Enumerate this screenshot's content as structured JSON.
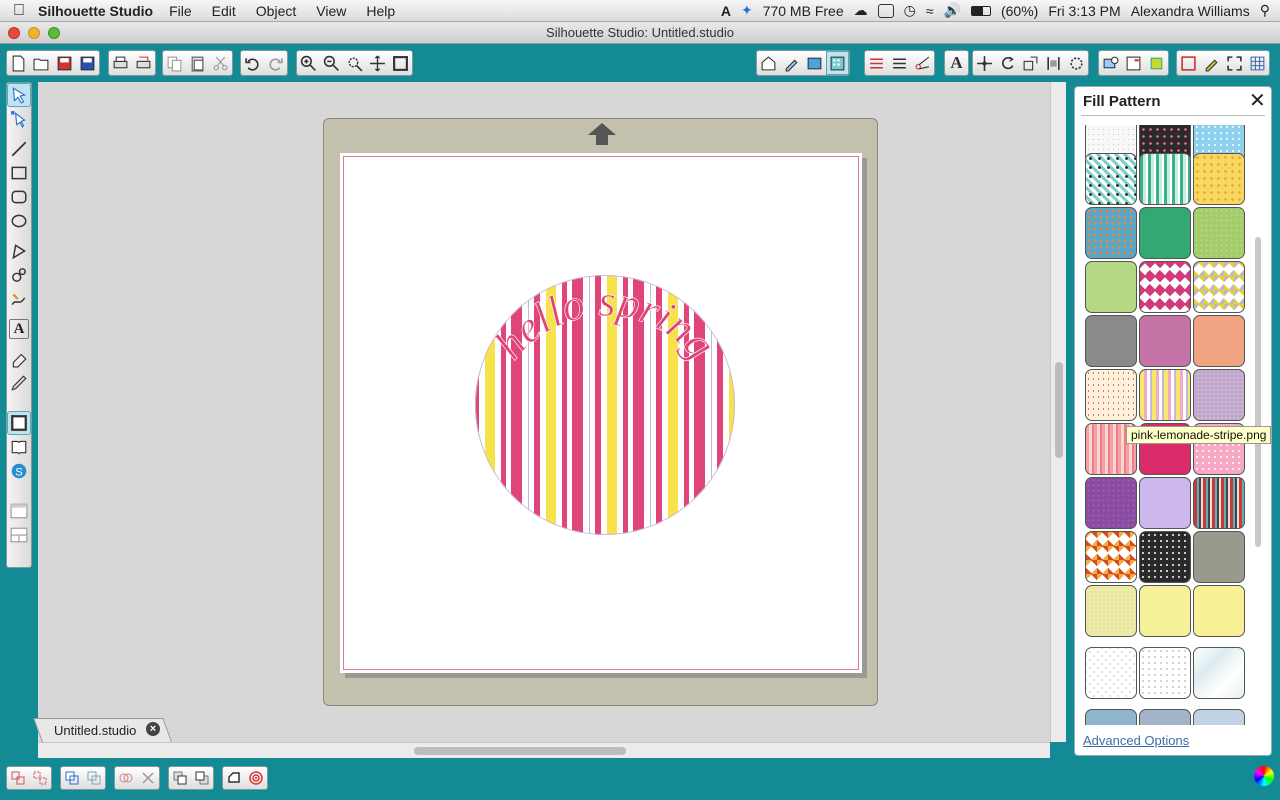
{
  "menubar": {
    "app_name": "Silhouette Studio",
    "menus": [
      "File",
      "Edit",
      "Object",
      "View",
      "Help"
    ],
    "memory": "770 MB Free",
    "battery": "(60%)",
    "clock": "Fri 3:13 PM",
    "user": "Alexandra Williams"
  },
  "window": {
    "title": "Silhouette Studio: Untitled.studio"
  },
  "document": {
    "tab_label": "Untitled.studio",
    "design_text": "hello spring",
    "colors": {
      "pink": "#e0457a",
      "yellow": "#f7e24a",
      "lavender": "#c8b6e0",
      "mat": "#c3c0ad",
      "teal": "#148a94"
    }
  },
  "panel": {
    "title": "Fill Pattern",
    "tooltip": "pink-lemonade-stripe.png",
    "advanced_link": "Advanced Options"
  }
}
